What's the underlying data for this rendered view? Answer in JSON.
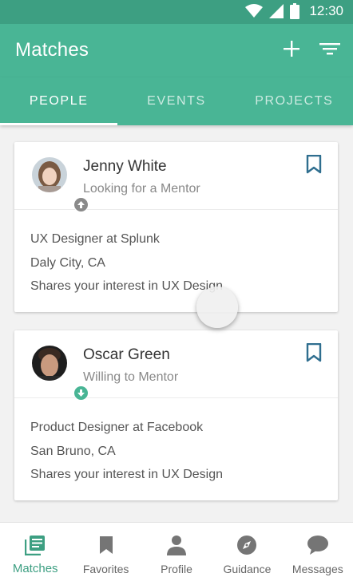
{
  "status_bar": {
    "time": "12:30"
  },
  "app_bar": {
    "title": "Matches"
  },
  "tabs": [
    {
      "label": "PEOPLE",
      "active": true
    },
    {
      "label": "EVENTS",
      "active": false
    },
    {
      "label": "PROJECTS",
      "active": false
    }
  ],
  "matches": [
    {
      "name": "Jenny White",
      "role": "Looking for a Mentor",
      "details": [
        "UX Designer at Splunk",
        "Daly City, CA",
        "Shares your interest in UX Design"
      ]
    },
    {
      "name": "Oscar Green",
      "role": "Willing to Mentor",
      "details": [
        "Product Designer at Facebook",
        "San Bruno, CA",
        "Shares your interest in UX Design"
      ]
    }
  ],
  "bottom_nav": [
    {
      "label": "Matches",
      "icon": "matches-icon",
      "active": true
    },
    {
      "label": "Favorites",
      "icon": "bookmark-icon",
      "active": false
    },
    {
      "label": "Profile",
      "icon": "person-icon",
      "active": false
    },
    {
      "label": "Guidance",
      "icon": "compass-icon",
      "active": false
    },
    {
      "label": "Messages",
      "icon": "chat-bubble-icon",
      "active": false
    }
  ],
  "colors": {
    "primary": "#49b595",
    "primary_dark": "#3d9f82",
    "bookmark": "#2f6e8f",
    "mentee_badge": "#8a8a8a"
  }
}
